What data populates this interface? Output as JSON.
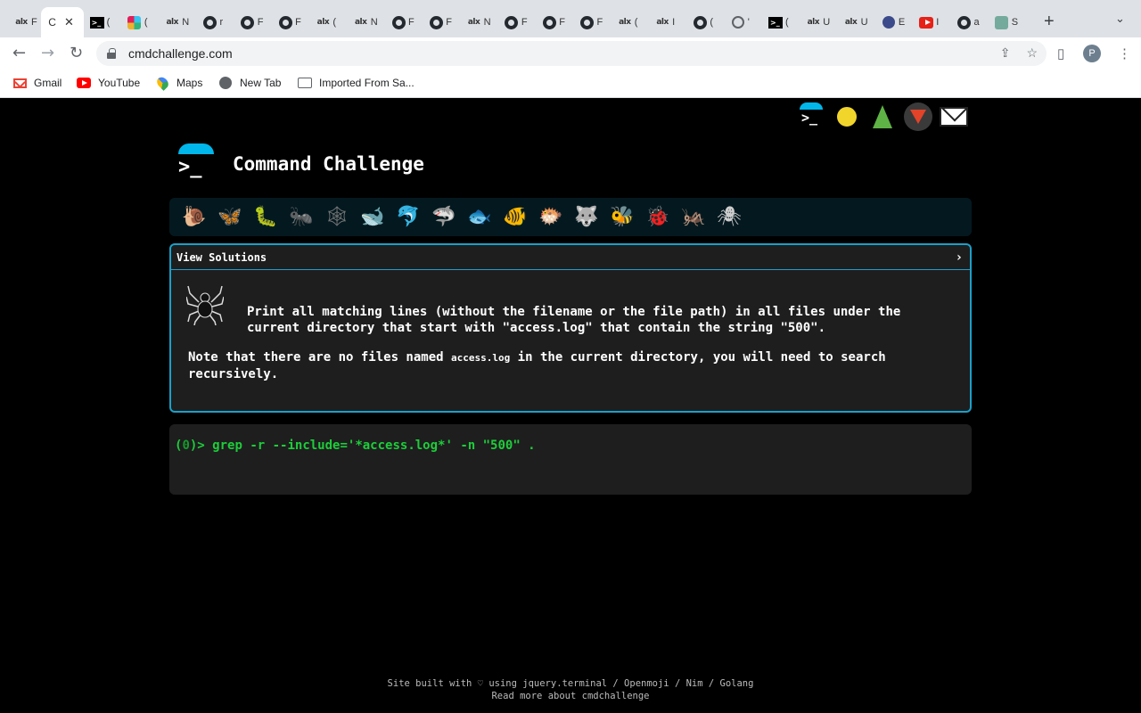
{
  "browser": {
    "tabs": [
      {
        "favicon": "alx-icon",
        "title": "F"
      },
      {
        "favicon": "cmdchallenge-icon",
        "title": "C",
        "active": true
      },
      {
        "favicon": "terminal-icon",
        "title": "("
      },
      {
        "favicon": "slack-icon",
        "title": "("
      },
      {
        "favicon": "alx-icon",
        "title": "N"
      },
      {
        "favicon": "github-icon",
        "title": "r"
      },
      {
        "favicon": "github-icon",
        "title": "F"
      },
      {
        "favicon": "github-icon",
        "title": "F"
      },
      {
        "favicon": "alx-icon",
        "title": "("
      },
      {
        "favicon": "alx-icon",
        "title": "N"
      },
      {
        "favicon": "github-icon",
        "title": "F"
      },
      {
        "favicon": "github-icon",
        "title": "F"
      },
      {
        "favicon": "alx-icon",
        "title": "N"
      },
      {
        "favicon": "github-icon",
        "title": "F"
      },
      {
        "favicon": "github-icon",
        "title": "F"
      },
      {
        "favicon": "github-icon",
        "title": "F"
      },
      {
        "favicon": "alx-icon",
        "title": "("
      },
      {
        "favicon": "alx-icon",
        "title": "I"
      },
      {
        "favicon": "github-icon",
        "title": "("
      },
      {
        "favicon": "globe-icon",
        "title": "'"
      },
      {
        "favicon": "terminal-icon",
        "title": "("
      },
      {
        "favicon": "alx-icon",
        "title": "U"
      },
      {
        "favicon": "alx-icon",
        "title": "U"
      },
      {
        "favicon": "moon-icon",
        "title": "E"
      },
      {
        "favicon": "youtube-icon",
        "title": "I"
      },
      {
        "favicon": "github-icon",
        "title": "a"
      },
      {
        "favicon": "chatgpt-icon",
        "title": "S"
      }
    ],
    "url": "cmdchallenge.com",
    "avatar_letter": "P",
    "bookmarks": [
      {
        "icon": "gmail-icon",
        "label": "Gmail"
      },
      {
        "icon": "youtube-icon",
        "label": "YouTube"
      },
      {
        "icon": "maps-icon",
        "label": "Maps"
      },
      {
        "icon": "globe-icon",
        "label": "New Tab"
      },
      {
        "icon": "folder-icon",
        "label": "Imported From Sa..."
      }
    ]
  },
  "site": {
    "title": "Command Challenge",
    "header_icons": [
      "cmdchallenge-logo-icon",
      "shushing-face-icon",
      "evergreen-tree-icon",
      "gitlab-icon",
      "envelope-icon"
    ],
    "levels": [
      {
        "name": "snail",
        "glyph": "🐌",
        "color": "#a0522d"
      },
      {
        "name": "butterfly",
        "glyph": "🦋",
        "color": "#d9822b"
      },
      {
        "name": "caterpillar",
        "glyph": "🐛",
        "color": "#5cb85c"
      },
      {
        "name": "ant",
        "glyph": "🐜",
        "color": "#555555"
      },
      {
        "name": "web",
        "glyph": "🕸",
        "color": "#777777"
      },
      {
        "name": "whale",
        "glyph": "🐋",
        "color": "#4a90c8"
      },
      {
        "name": "dolphin",
        "glyph": "🐬",
        "color": "#4a90c8"
      },
      {
        "name": "shark",
        "glyph": "🦈",
        "color": "#8a9aa8"
      },
      {
        "name": "fish",
        "glyph": "🐟",
        "color": "#4a90c8"
      },
      {
        "name": "tropical-fish",
        "glyph": "🐠",
        "color": "#e8b22a"
      },
      {
        "name": "blowfish",
        "glyph": "🐡",
        "color": "#b07a3a"
      },
      {
        "name": "wolf",
        "glyph": "🐺",
        "color": "#9a9a9a"
      },
      {
        "name": "bee",
        "glyph": "🐝",
        "color": "#e8c22a"
      },
      {
        "name": "ladybug",
        "glyph": "🐞",
        "color": "#d9312b"
      },
      {
        "name": "cricket",
        "glyph": "🦗",
        "color": "#5cb85c"
      },
      {
        "name": "spider",
        "glyph": "🕷",
        "color": "#cccccc"
      }
    ],
    "panel": {
      "header": "View Solutions",
      "task": "Print all matching lines (without the filename or the file path) in all files under the current directory that start with \"access.log\" that contain the string \"500\".",
      "note_before": "Note that there are no files named ",
      "note_code": "access.log",
      "note_after": " in the current directory, you will need to search recursively."
    },
    "terminal": {
      "prompt_open": "(",
      "prompt_num": "0",
      "prompt_close": ")> ",
      "command": "grep -r --include='*access.log*' -n \"500\" ."
    },
    "footer": {
      "line1": "Site built with ♡ using jquery.terminal / Openmoji / Nim / Golang",
      "line2": "Read more about cmdchallenge"
    },
    "accent": "#1ca0c8",
    "prompt_color": "#1dcd3a"
  }
}
